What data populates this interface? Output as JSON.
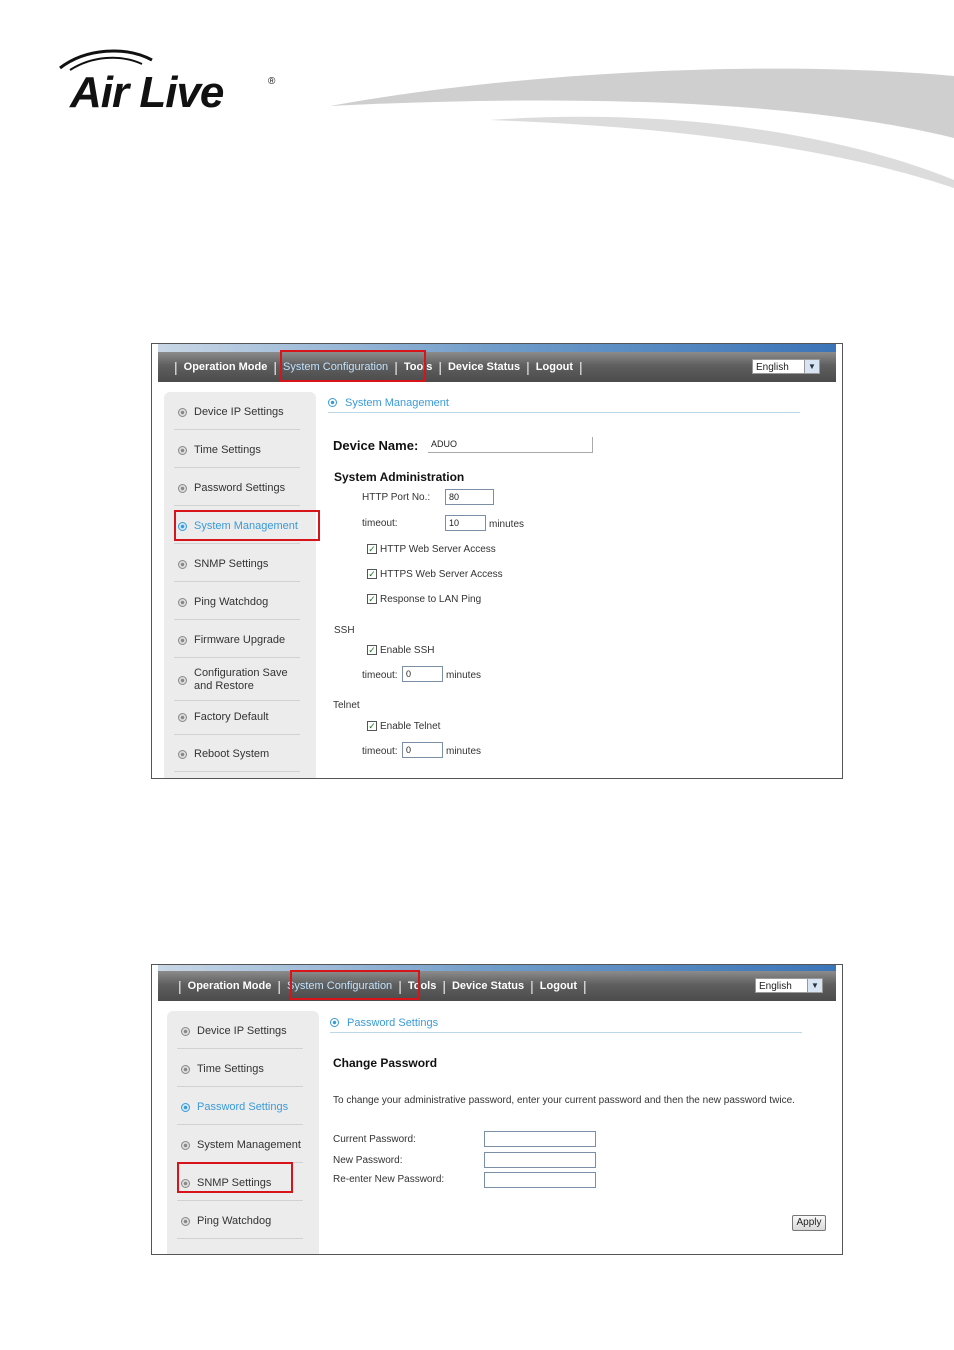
{
  "brand": {
    "logo_text": "Air Live",
    "registered": "®"
  },
  "colors": {
    "accent_blue": "#3a9ad9",
    "highlight_red": "#d8141b",
    "nav_bg": "#5f5f5f"
  },
  "nav": {
    "items": [
      "Operation Mode",
      "System Configuration",
      "Tools",
      "Device Status",
      "Logout"
    ],
    "language": "English"
  },
  "shot1": {
    "sidebar": [
      "Device IP Settings",
      "Time Settings",
      "Password Settings",
      "System Management",
      "SNMP Settings",
      "Ping Watchdog",
      "Firmware Upgrade",
      "Configuration Save",
      "and Restore",
      "Factory Default",
      "Reboot System"
    ],
    "section_title": "System Management",
    "device_name_label": "Device Name:",
    "device_name_value": "ADUO",
    "sys_admin_heading": "System Administration",
    "http_port_label": "HTTP Port No.:",
    "http_port_value": "80",
    "timeout_label": "timeout:",
    "timeout_value": "10",
    "minutes": "minutes",
    "http_access": "HTTP Web Server Access",
    "https_access": "HTTPS Web Server Access",
    "lan_ping": "Response to LAN Ping",
    "ssh_heading": "SSH",
    "enable_ssh": "Enable SSH",
    "ssh_timeout_value": "0",
    "telnet_heading": "Telnet",
    "enable_telnet": "Enable Telnet",
    "telnet_timeout_value": "0",
    "check_mark": "✓"
  },
  "shot2": {
    "sidebar": [
      "Device IP Settings",
      "Time Settings",
      "Password Settings",
      "System Management",
      "SNMP Settings",
      "Ping Watchdog"
    ],
    "section_title": "Password Settings",
    "heading": "Change Password",
    "instructions": "To change your administrative password, enter your current password and then the new password twice.",
    "current_password_label": "Current Password:",
    "new_password_label": "New Password:",
    "reenter_password_label": "Re-enter New Password:",
    "apply_label": "Apply"
  }
}
